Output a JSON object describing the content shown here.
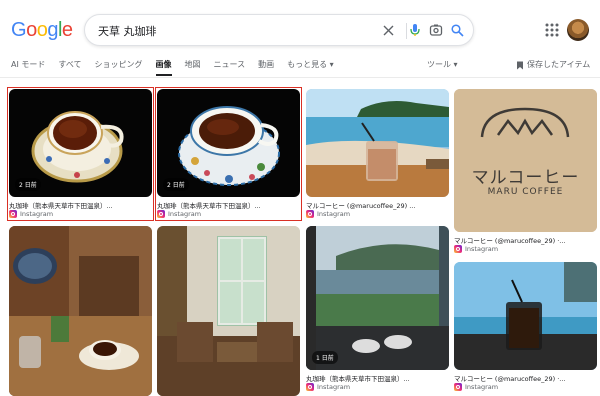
{
  "search": {
    "query": "天草 丸珈琲"
  },
  "tabs": [
    "AI モード",
    "すべて",
    "ショッピング",
    "画像",
    "地図",
    "ニュース",
    "動画",
    "もっと見る ▾"
  ],
  "tools_label": "ツール ▾",
  "saved_label": "保存したアイテム",
  "results": [
    {
      "caption": "丸珈琲（熊本県天草市下田温泉）...",
      "source": "Instagram",
      "badge": "2 日前"
    },
    {
      "caption": "丸珈琲（熊本県天草市下田温泉）...",
      "source": "Instagram",
      "badge": "2 日前"
    },
    {
      "caption": "マルコーヒー (@marucoffee_29) ...",
      "source": "Instagram",
      "badge": ""
    },
    {
      "caption": "マルコーヒー (@marucoffee_29) ·...",
      "source": "Instagram",
      "badge": "",
      "sign_text": "マルコーヒー",
      "sign_sub": "MARU COFFEE"
    },
    {
      "caption": "",
      "source": "",
      "badge": ""
    },
    {
      "caption": "",
      "source": "",
      "badge": ""
    },
    {
      "caption": "丸珈琲（熊本県天草市下田温泉）...",
      "source": "Instagram",
      "badge": "1 日前"
    },
    {
      "caption": "マルコーヒー (@marucoffee_29) ·...",
      "source": "Instagram",
      "badge": ""
    }
  ]
}
